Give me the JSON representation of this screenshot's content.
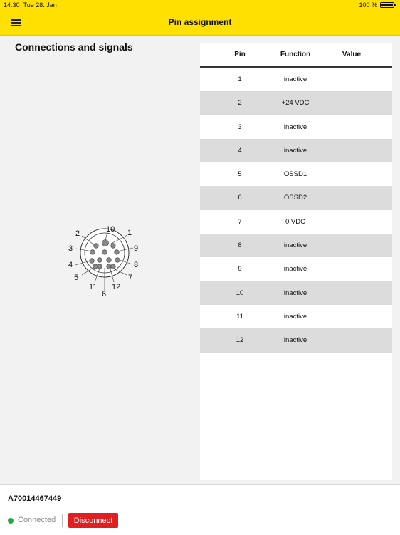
{
  "status_bar": {
    "time": "14:30",
    "date": "Tue 28. Jan",
    "battery": "100 %"
  },
  "nav": {
    "title": "Pin assignment",
    "menu_icon": "hamburger-menu-icon"
  },
  "section_title": "Connections and signals",
  "connector": {
    "icon": "12-pin-connector-diagram",
    "labels": [
      "1",
      "2",
      "3",
      "4",
      "5",
      "6",
      "7",
      "8",
      "9",
      "10",
      "11",
      "12"
    ]
  },
  "table": {
    "headers": {
      "pin": "Pin",
      "function": "Function",
      "value": "Value"
    },
    "rows": [
      {
        "pin": "1",
        "function": "inactive",
        "value": ""
      },
      {
        "pin": "2",
        "function": "+24 VDC",
        "value": ""
      },
      {
        "pin": "3",
        "function": "inactive",
        "value": ""
      },
      {
        "pin": "4",
        "function": "inactive",
        "value": ""
      },
      {
        "pin": "5",
        "function": "OSSD1",
        "value": ""
      },
      {
        "pin": "6",
        "function": "OSSD2",
        "value": ""
      },
      {
        "pin": "7",
        "function": "0 VDC",
        "value": ""
      },
      {
        "pin": "8",
        "function": "inactive",
        "value": ""
      },
      {
        "pin": "9",
        "function": "inactive",
        "value": ""
      },
      {
        "pin": "10",
        "function": "inactive",
        "value": ""
      },
      {
        "pin": "11",
        "function": "inactive",
        "value": ""
      },
      {
        "pin": "12",
        "function": "inactive",
        "value": ""
      }
    ]
  },
  "footer": {
    "device_id": "A70014467449",
    "status": "Connected",
    "status_color": "#1eaa3c",
    "disconnect_label": "Disconnect",
    "disconnect_color": "#e02020"
  },
  "colors": {
    "accent": "#ffe000"
  }
}
